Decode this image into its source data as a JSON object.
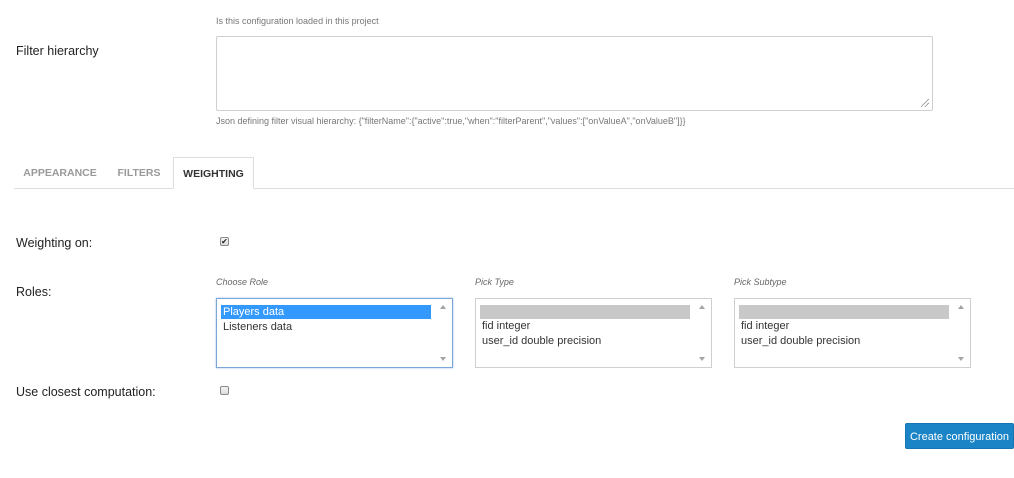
{
  "filter_hierarchy": {
    "hint_top": "Is this configuration loaded in this project",
    "label": "Filter hierarchy",
    "value": "",
    "hint_bottom": "Json defining filter visual hierarchy: {\"filterName\":{\"active\":true,\"when\":\"filterParent\",\"values\":[\"onValueA\",\"onValueB\"]}}"
  },
  "tabs": [
    {
      "label": "APPEARANCE",
      "active": false
    },
    {
      "label": "FILTERS",
      "active": false
    },
    {
      "label": "WEIGHTING",
      "active": true
    }
  ],
  "weighting": {
    "label": "Weighting on:",
    "checked": true,
    "check_glyph": "✔"
  },
  "roles": {
    "label": "Roles:",
    "choose_role": {
      "caption": "Choose Role",
      "options": [
        "Players data",
        "Listeners data"
      ],
      "selected": 0
    },
    "pick_type": {
      "caption": "Pick Type",
      "options": [
        "",
        "fid integer",
        "user_id double precision"
      ],
      "selected": 0
    },
    "pick_subtype": {
      "caption": "Pick Subtype",
      "options": [
        "",
        "fid integer",
        "user_id double precision"
      ],
      "selected": 0
    }
  },
  "closest": {
    "label": "Use closest computation:",
    "checked": false
  },
  "actions": {
    "create_label": "Create configuration"
  },
  "colors": {
    "primary_button": "#1a84c7",
    "selection_blue": "#3399ff",
    "selection_grey": "#c8c8c8"
  }
}
